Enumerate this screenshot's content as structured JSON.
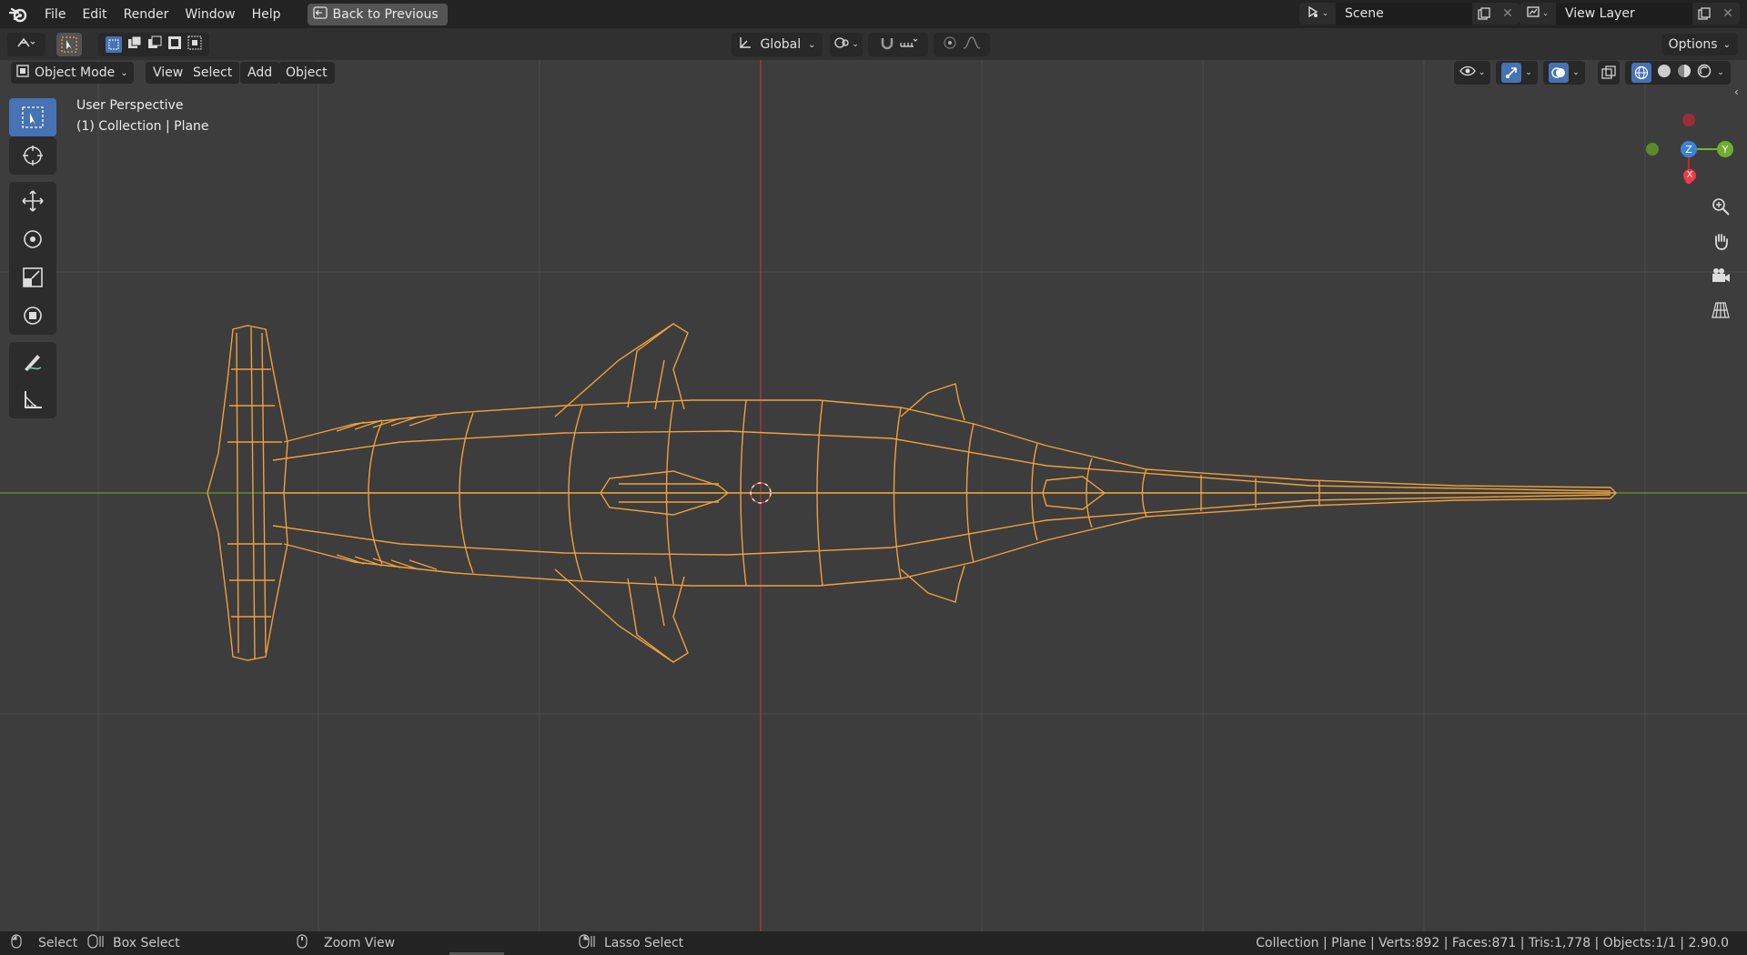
{
  "topbar": {
    "menus": [
      "File",
      "Edit",
      "Render",
      "Window",
      "Help"
    ],
    "back_button": "Back to Previous",
    "scene_name": "Scene",
    "view_layer": "View Layer"
  },
  "toolbar": {
    "transform_orientation": "Global",
    "options_label": "Options"
  },
  "viewport_header": {
    "mode": "Object Mode",
    "menus": [
      "View",
      "Select",
      "Add",
      "Object"
    ]
  },
  "viewport": {
    "perspective_label": "User Perspective",
    "collection_label": "(1) Collection | Plane"
  },
  "gizmo": {
    "z": "Z",
    "y": "Y",
    "x": "X"
  },
  "statusbar": {
    "select": "Select",
    "box_select": "Box Select",
    "zoom_view": "Zoom View",
    "lasso_select": "Lasso Select",
    "stats": "Collection | Plane | Verts:892 | Faces:871 | Tris:1,778 | Objects:1/1 | 2.90.0"
  },
  "colors": {
    "accent_blue": "#4772b3",
    "wire_orange": "#f0a03c",
    "axis_red": "#b03030",
    "axis_green": "#6a9a2c",
    "viewport_bg": "#3d3d3d"
  }
}
